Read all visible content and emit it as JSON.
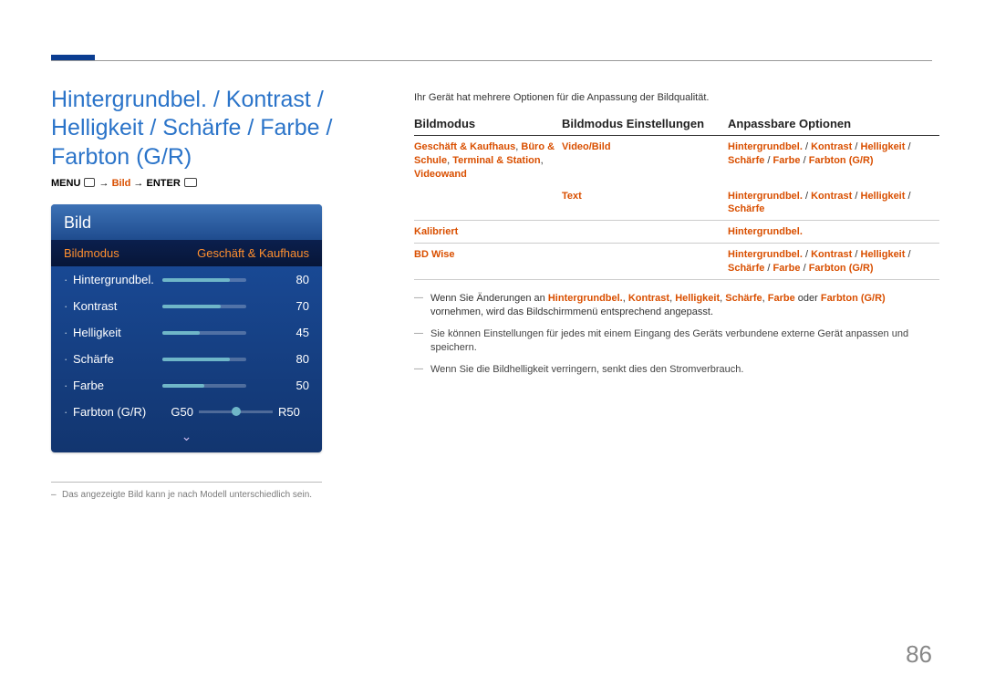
{
  "page_title": "Hintergrundbel. / Kontrast / Helligkeit / Schärfe / Farbe / Farbton (G/R)",
  "menu_path": {
    "menu_label": "MENU",
    "arrow": "→",
    "step": "Bild",
    "enter_label": "ENTER"
  },
  "osd": {
    "title": "Bild",
    "selected": {
      "label": "Bildmodus",
      "value": "Geschäft & Kaufhaus"
    },
    "sliders": [
      {
        "label": "Hintergrundbel.",
        "value": 80
      },
      {
        "label": "Kontrast",
        "value": 70
      },
      {
        "label": "Helligkeit",
        "value": 45
      },
      {
        "label": "Schärfe",
        "value": 80
      },
      {
        "label": "Farbe",
        "value": 50
      }
    ],
    "gr": {
      "label": "Farbton (G/R)",
      "g": "G50",
      "r": "R50"
    },
    "footnote": "Das angezeigte Bild kann je nach Modell unterschiedlich sein."
  },
  "intro": "Ihr Gerät hat mehrere Optionen für die Anpassung der Bildqualität.",
  "table": {
    "headers": {
      "c1": "Bildmodus",
      "c2": "Bildmodus Einstellungen",
      "c3": "Anpassbare Optionen"
    },
    "rows": [
      {
        "c1": "Geschäft & Kaufhaus, Büro & Schule, Terminal & Station, Videowand",
        "c2": "Video/Bild",
        "c3": "Hintergrundbel. / Kontrast / Helligkeit / Schärfe / Farbe / Farbton (G/R)"
      },
      {
        "c1": "",
        "c2": "Text",
        "c3": "Hintergrundbel. / Kontrast / Helligkeit / Schärfe"
      },
      {
        "c1": "Kalibriert",
        "c2": "",
        "c3": "Hintergrundbel."
      },
      {
        "c1": "BD Wise",
        "c2": "",
        "c3": "Hintergrundbel. / Kontrast / Helligkeit / Schärfe / Farbe / Farbton (G/R)"
      }
    ]
  },
  "notes": [
    {
      "prefix": "Wenn Sie Änderungen an ",
      "terms": [
        "Hintergrundbel.",
        "Kontrast",
        "Helligkeit",
        "Schärfe",
        "Farbe"
      ],
      "join_last": " oder ",
      "last_term": "Farbton (G/R)",
      "suffix": " vornehmen, wird das Bildschirmmenü entsprechend angepasst."
    },
    {
      "plain": "Sie können Einstellungen für jedes mit einem Eingang des Geräts verbundene externe Gerät anpassen und speichern."
    },
    {
      "plain": "Wenn Sie die Bildhelligkeit verringern, senkt dies den Stromverbrauch."
    }
  ],
  "page_number": "86"
}
